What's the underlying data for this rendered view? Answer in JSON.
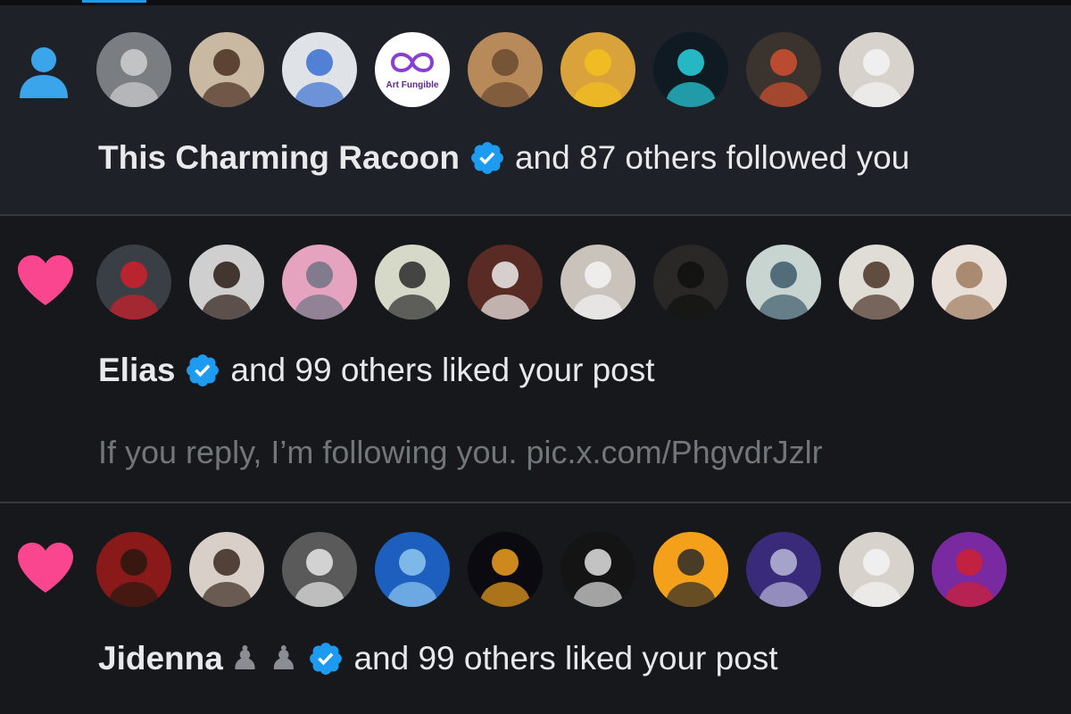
{
  "notifications": [
    {
      "type": "follow",
      "type_icon": "person-icon",
      "name": "This Charming Racoon",
      "verified": true,
      "action": "and 87 others followed you",
      "avatars": [
        {
          "label": "raccoon",
          "bg": "#7a7d82",
          "fg": "#cfcfd0"
        },
        {
          "label": "man-beanie",
          "bg": "#c9b9a3",
          "fg": "#4a2e20"
        },
        {
          "label": "white-blue-art",
          "bg": "#dfe3e8",
          "fg": "#3a6fd0"
        },
        {
          "label": "Art Fungible",
          "bg": "#ffffff",
          "fg": "#7b3fc4"
        },
        {
          "label": "man-selfie",
          "bg": "#b88a5a",
          "fg": "#6a4a30"
        },
        {
          "label": "rubber-duck",
          "bg": "#d9a23a",
          "fg": "#f3c020"
        },
        {
          "label": "neon-figure",
          "bg": "#0f1a22",
          "fg": "#2ad3e0"
        },
        {
          "label": "dark-logo",
          "bg": "#3a332e",
          "fg": "#d05030"
        },
        {
          "label": "man-white-shirt",
          "bg": "#d7d2cc",
          "fg": "#f4f4f4"
        }
      ]
    },
    {
      "type": "like",
      "type_icon": "heart-icon",
      "name": "Elias",
      "verified": true,
      "action": "and 99 others liked your post",
      "post_text": "If you reply, I’m following you. pic.x.com/PhgvdrJzlr",
      "avatars": [
        {
          "label": "football-20",
          "bg": "#3a3e45",
          "fg": "#d0202a"
        },
        {
          "label": "afro-woman",
          "bg": "#cfcfcf",
          "fg": "#2a1a14"
        },
        {
          "label": "gray-cat-cartoon",
          "bg": "#e6a3c0",
          "fg": "#6e7484"
        },
        {
          "label": "ape-goggles",
          "bg": "#d6d8c8",
          "fg": "#2a2a2a"
        },
        {
          "label": "mime",
          "bg": "#5a2a24",
          "fg": "#ececec"
        },
        {
          "label": "man-white-outfit",
          "bg": "#c9c3bb",
          "fg": "#f4f4f4"
        },
        {
          "label": "black-cat",
          "bg": "#2a2826",
          "fg": "#0f0f0f"
        },
        {
          "label": "sketch-logo",
          "bg": "#c8d4d0",
          "fg": "#3b5a6a"
        },
        {
          "label": "boy-portrait",
          "bg": "#e0dcd6",
          "fg": "#4a3226"
        },
        {
          "label": "woman-gesture",
          "bg": "#e8e0d8",
          "fg": "#a07a60"
        }
      ]
    },
    {
      "type": "like",
      "type_icon": "heart-icon",
      "name": "Jidenna",
      "name_suffix": "♟ ♟",
      "verified": true,
      "action": "and 99 others liked your post",
      "avatars": [
        {
          "label": "cartoon-afro",
          "bg": "#8a1a1a",
          "fg": "#2a1810"
        },
        {
          "label": "woman-hair",
          "bg": "#d8cfc8",
          "fg": "#3a2820"
        },
        {
          "label": "white-kitten",
          "bg": "#5a5a5a",
          "fg": "#e8e8e8"
        },
        {
          "label": "blue-cartoon-guy",
          "bg": "#1d5fbf",
          "fg": "#8ec8f0"
        },
        {
          "label": "eclipse",
          "bg": "#0a0a10",
          "fg": "#f0a020"
        },
        {
          "label": "anime-sketch",
          "bg": "#141414",
          "fg": "#e0e0e0"
        },
        {
          "label": "bearded-cartoon",
          "bg": "#f4a01a",
          "fg": "#2a2a2a"
        },
        {
          "label": "stage-performer",
          "bg": "#3a2a7a",
          "fg": "#b8b8d8"
        },
        {
          "label": "man-white-shirt",
          "bg": "#d7d2cc",
          "fg": "#f4f4f4"
        },
        {
          "label": "woman-red-hat",
          "bg": "#7a2aa0",
          "fg": "#d02030"
        }
      ]
    }
  ],
  "colors": {
    "verified": "#1d9bf0",
    "heart": "#f91880",
    "person": "#1d9bf0",
    "text_primary": "#e7e9ea",
    "text_secondary": "#71767b"
  }
}
